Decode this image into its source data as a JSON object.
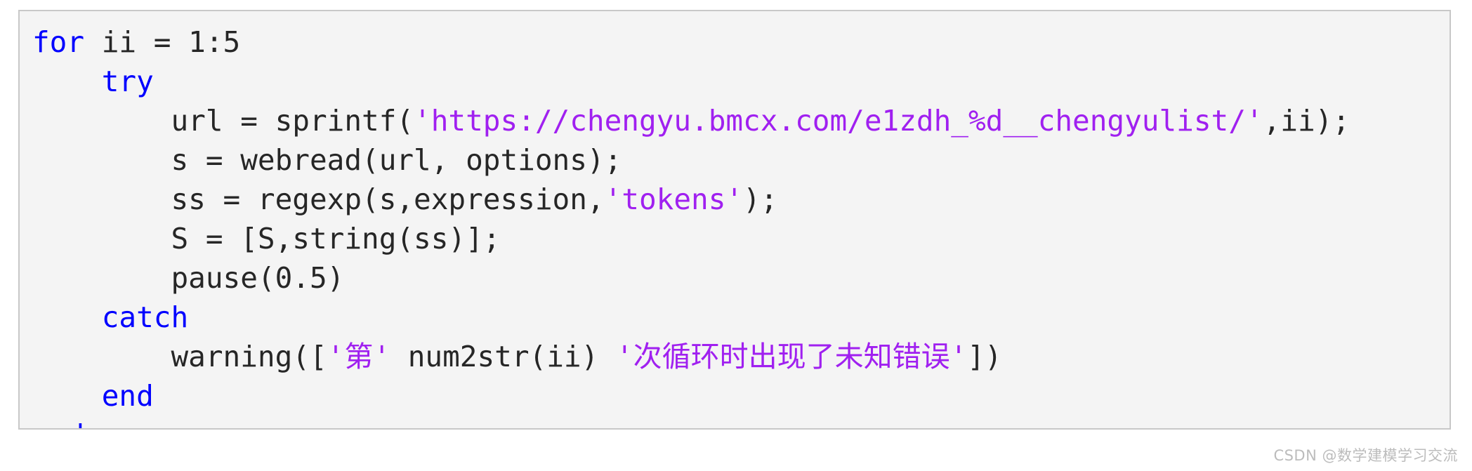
{
  "code_block": {
    "language": "matlab",
    "background_color": "#f4f4f4",
    "border_color": "#c8c8c8",
    "colors": {
      "keyword": "#0000ff",
      "string": "#a020f0",
      "plain": "#262626"
    },
    "lines": [
      {
        "indent": "",
        "tokens": [
          {
            "type": "keyword",
            "text": "for"
          },
          {
            "type": "plain",
            "text": " ii = 1:5"
          }
        ]
      },
      {
        "indent": "    ",
        "tokens": [
          {
            "type": "keyword",
            "text": "try"
          }
        ]
      },
      {
        "indent": "        ",
        "tokens": [
          {
            "type": "plain",
            "text": "url = sprintf("
          },
          {
            "type": "string",
            "text": "'https://chengyu.bmcx.com/e1zdh_%d__chengyulist/'"
          },
          {
            "type": "plain",
            "text": ",ii);"
          }
        ]
      },
      {
        "indent": "        ",
        "tokens": [
          {
            "type": "plain",
            "text": "s = webread(url, options);"
          }
        ]
      },
      {
        "indent": "        ",
        "tokens": [
          {
            "type": "plain",
            "text": "ss = regexp(s,expression,"
          },
          {
            "type": "string",
            "text": "'tokens'"
          },
          {
            "type": "plain",
            "text": ");"
          }
        ]
      },
      {
        "indent": "        ",
        "tokens": [
          {
            "type": "plain",
            "text": "S = [S,string(ss)];"
          }
        ]
      },
      {
        "indent": "        ",
        "tokens": [
          {
            "type": "plain",
            "text": "pause(0.5)"
          }
        ]
      },
      {
        "indent": "    ",
        "tokens": [
          {
            "type": "keyword",
            "text": "catch"
          }
        ]
      },
      {
        "indent": "        ",
        "tokens": [
          {
            "type": "plain",
            "text": "warning(["
          },
          {
            "type": "string",
            "text": "'第'"
          },
          {
            "type": "plain",
            "text": " num2str(ii) "
          },
          {
            "type": "string",
            "text": "'次循环时出现了未知错误'"
          },
          {
            "type": "plain",
            "text": "])"
          }
        ]
      },
      {
        "indent": "    ",
        "tokens": [
          {
            "type": "keyword",
            "text": "end"
          }
        ]
      },
      {
        "indent": "",
        "tokens": [
          {
            "type": "keyword",
            "text": "end"
          }
        ]
      }
    ]
  },
  "watermark": {
    "text": "CSDN @数学建模学习交流",
    "color": "#bcbcbc"
  }
}
